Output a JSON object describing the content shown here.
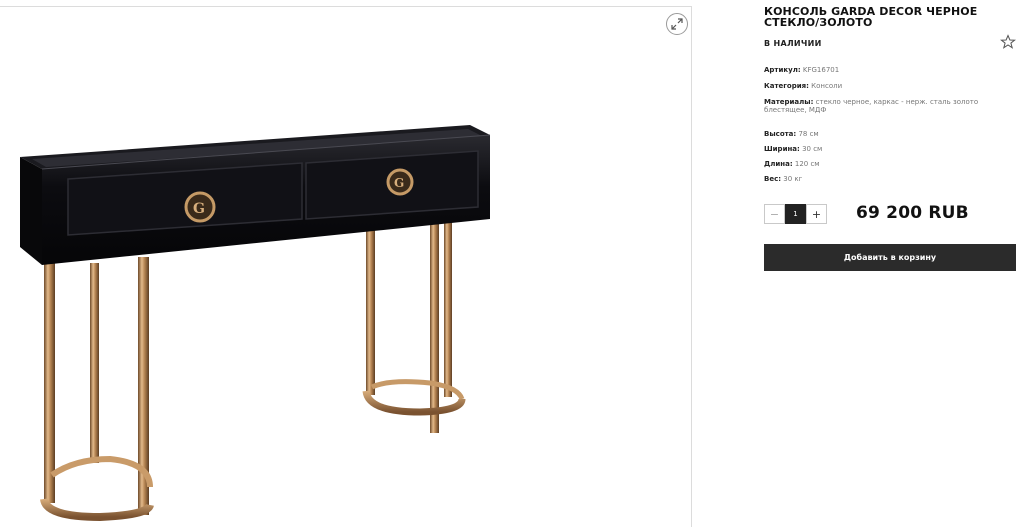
{
  "product": {
    "title": "КОНСОЛЬ GARDA DECOR ЧЕРНОЕ СТЕКЛО/ЗОЛОТО",
    "stock_status": "В НАЛИЧИИ",
    "image_alt": "Консоль Garda Decor",
    "specs": {
      "article_label": "Артикул:",
      "article_value": "KFG16701",
      "category_label": "Категория:",
      "category_value": "Консоли",
      "materials_label": "Материалы:",
      "materials_value": "стекло черное, каркас - нерж. сталь золото блестящее, МДФ",
      "height_label": "Высота:",
      "height_value": "78 см",
      "width_label": "Ширина:",
      "width_value": "30 см",
      "length_label": "Длина:",
      "length_value": "120 см",
      "weight_label": "Вес:",
      "weight_value": "30 кг"
    },
    "quantity": {
      "minus": "−",
      "value": "1",
      "plus": "+"
    },
    "price": "69 200 RUB",
    "add_to_cart": "Добавить в корзину"
  },
  "icons": {
    "zoom": "expand-icon",
    "favorite": "star-outline-icon"
  },
  "colors": {
    "button_bg": "#2b2b2b",
    "gold": "#b8895a",
    "black_glass": "#0d0d10"
  }
}
